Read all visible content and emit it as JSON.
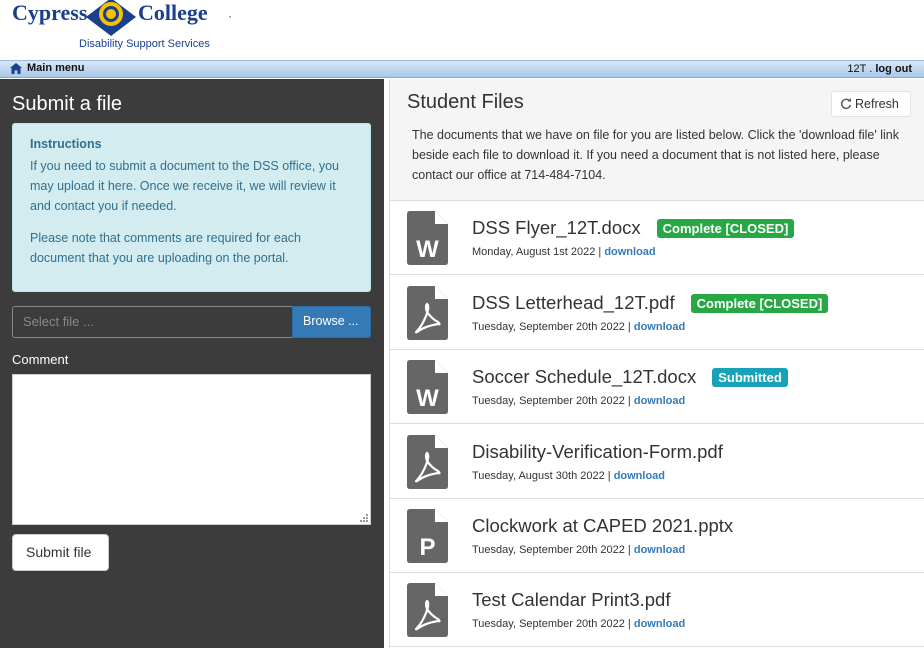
{
  "header": {
    "logo_left": "Cypress",
    "logo_right": "College",
    "logo_sub": "Disability Support Services"
  },
  "navbar": {
    "main_menu": "Main menu",
    "user": "12T .",
    "logout": "log out"
  },
  "submit_panel": {
    "title": "Submit a file",
    "instructions_title": "Instructions",
    "instructions_p1": "If you need to submit a document to the DSS office, you may upload it here. Once we receive it, we will review it and contact you if needed.",
    "instructions_p2": "Please note that comments are required for each document that you are uploading on the portal.",
    "file_placeholder": "Select file ...",
    "browse_label": "Browse ...",
    "comment_label": "Comment",
    "submit_label": "Submit file"
  },
  "files_panel": {
    "title": "Student Files",
    "refresh_label": "Refresh",
    "description": "The documents that we have on file for you are listed below. Click the 'download file' link beside each file to download it. If you need a document that is not listed here, please contact our office at 714-484-7104.",
    "download_label": "download",
    "files": [
      {
        "name": "DSS Flyer_12T.docx",
        "status": "Complete [CLOSED]",
        "status_type": "complete",
        "date": "Monday, August 1st 2022 |",
        "icon": "word-doc-icon",
        "letter": "W"
      },
      {
        "name": "DSS Letterhead_12T.pdf",
        "status": "Complete [CLOSED]",
        "status_type": "complete",
        "date": "Tuesday, September 20th 2022 |",
        "icon": "pdf-doc-icon",
        "letter": ""
      },
      {
        "name": "Soccer Schedule_12T.docx",
        "status": "Submitted",
        "status_type": "submitted",
        "date": "Tuesday, September 20th 2022 |",
        "icon": "word-doc-icon",
        "letter": "W"
      },
      {
        "name": "Disability-Verification-Form.pdf",
        "status": "",
        "status_type": "",
        "date": "Tuesday, August 30th 2022 |",
        "icon": "pdf-doc-icon",
        "letter": ""
      },
      {
        "name": "Clockwork at CAPED 2021.pptx",
        "status": "",
        "status_type": "",
        "date": "Tuesday, September 20th 2022 |",
        "icon": "powerpoint-doc-icon",
        "letter": "P"
      },
      {
        "name": "Test Calendar Print3.pdf",
        "status": "",
        "status_type": "",
        "date": "Tuesday, September 20th 2022 |",
        "icon": "pdf-doc-icon",
        "letter": ""
      }
    ]
  },
  "colors": {
    "dark_panel": "#3c3c3c",
    "primary": "#337ab7",
    "complete": "#28a745",
    "submitted": "#17a2b8",
    "info_bg": "#d2ecf0"
  }
}
